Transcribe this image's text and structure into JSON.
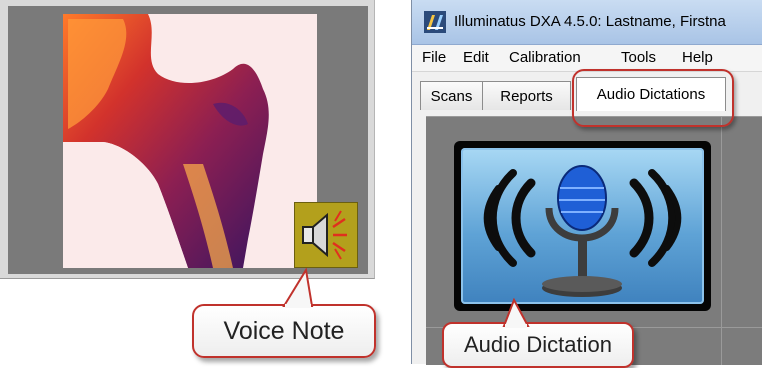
{
  "callouts": {
    "voice_note": "Voice Note",
    "audio_tab": "",
    "audio_dictation": "Audio Dictation"
  },
  "window": {
    "title": "Illuminatus DXA 4.5.0: Lastname, Firstna",
    "app_icon": "dxa-app-icon"
  },
  "menu": [
    "File",
    "Edit",
    "Calibration",
    "Tools",
    "Help"
  ],
  "tabs": [
    "Scans",
    "Reports",
    "Audio Dictations"
  ],
  "active_tab": "Audio Dictations",
  "icons": {
    "voice_note": "speaker-icon",
    "dictation": "microphone-icon"
  },
  "colors": {
    "callout_border": "#c0322c",
    "scan_background": "#fbeaea",
    "voice_note_bg": "#b3a01c",
    "dictation_blue": "#5fa3d6"
  }
}
